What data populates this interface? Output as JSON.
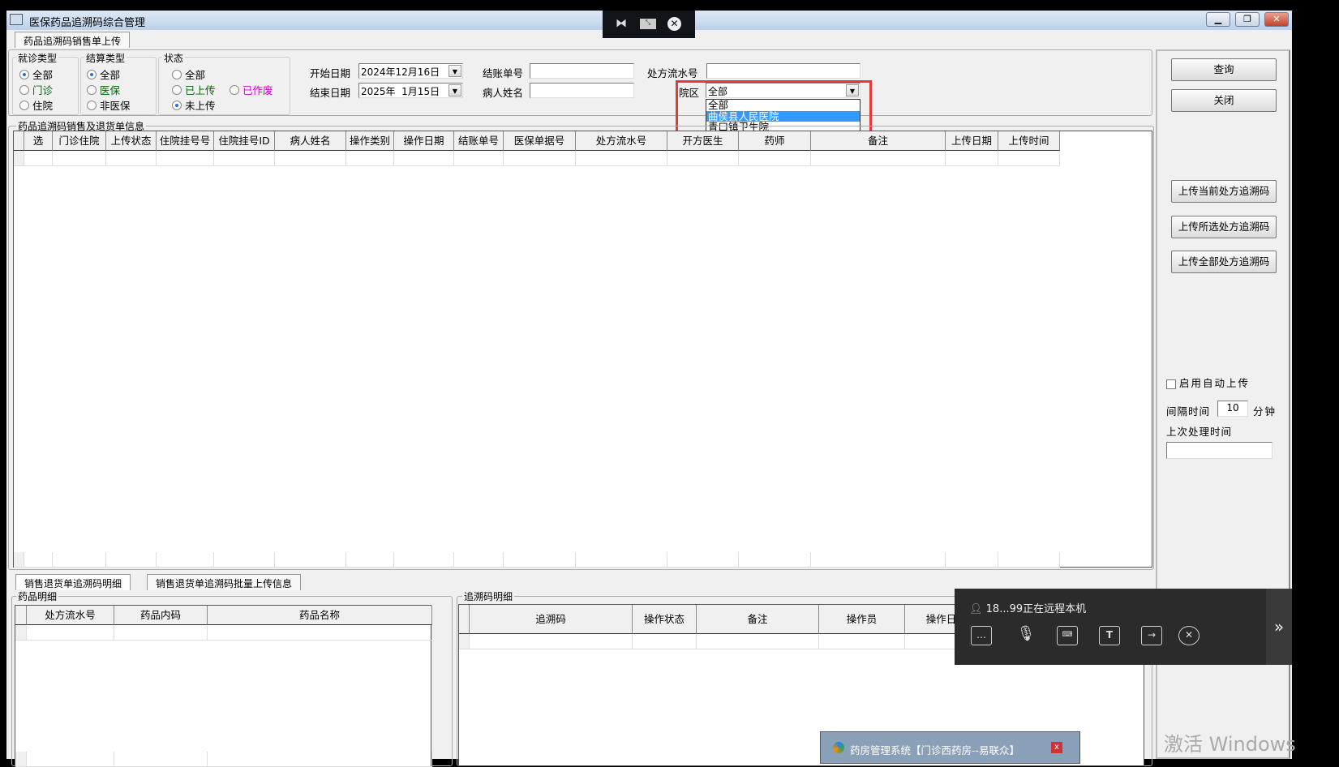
{
  "window": {
    "title": "医保药品追溯码综合管理",
    "main_tab": "药品追溯码销售单上传"
  },
  "filters": {
    "visit_type": {
      "label": "就诊类型",
      "options": [
        "全部",
        "门诊",
        "住院"
      ],
      "selected": 0
    },
    "settle_type": {
      "label": "结算类型",
      "options": [
        "全部",
        "医保",
        "非医保"
      ],
      "selected": 0
    },
    "status": {
      "label": "状态",
      "options": [
        "全部",
        "已上传",
        "已作废",
        "未上传"
      ],
      "selected": 3
    },
    "start_date_label": "开始日期",
    "start_date": "2024年12月16日",
    "end_date_label": "结束日期",
    "end_date": "2025年  1月15日",
    "bill_no_label": "结账单号",
    "bill_no": "",
    "patient_label": "病人姓名",
    "patient": "",
    "rx_serial_label": "处方流水号",
    "rx_serial": "",
    "campus_label": "院区",
    "campus": "全部",
    "campus_options": [
      "全部",
      "曲侯县人民医院",
      "青口镇卫生院"
    ],
    "campus_highlighted": 1
  },
  "main_grid": {
    "title": "药品追溯码销售及退货单信息",
    "columns": [
      "选",
      "门诊住院",
      "上传状态",
      "住院挂号号",
      "住院挂号ID",
      "病人姓名",
      "操作类别",
      "操作日期",
      "结账单号",
      "医保单据号",
      "处方流水号",
      "开方医生",
      "药师",
      "备注",
      "上传日期",
      "上传时间"
    ]
  },
  "side": {
    "query": "查询",
    "close": "关闭",
    "upload_current": "上传当前处方追溯码",
    "upload_selected": "上传所选处方追溯码",
    "upload_all": "上传全部处方追溯码",
    "auto_upload_label": "启用自动上传",
    "auto_upload": false,
    "interval_label": "间隔时间",
    "interval": "10",
    "interval_unit": "分钟",
    "last_time_label": "上次处理时间",
    "last_time": ""
  },
  "bottom": {
    "tabs": [
      "销售退货单追溯码明细",
      "销售退货单追溯码批量上传信息"
    ],
    "drug_group": "药品明细",
    "drug_columns": [
      "处方流水号",
      "药品内码",
      "药品名称"
    ],
    "trace_group": "追溯码明细",
    "trace_columns": [
      "追溯码",
      "操作状态",
      "备注",
      "操作员",
      "操作日"
    ]
  },
  "remote": {
    "status": "18...99正在远程本机"
  },
  "taskbar": {
    "window_title": "药房管理系统【门诊西药房--易联众】"
  },
  "watermark": "激活 Windows"
}
